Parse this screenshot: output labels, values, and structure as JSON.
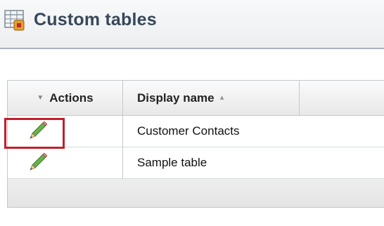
{
  "header": {
    "title": "Custom tables",
    "icon": "custom-tables-icon"
  },
  "grid": {
    "columns": {
      "actions": "Actions",
      "display_name": "Display name",
      "actions_sort_icon": "sort-down-icon",
      "display_name_sort_icon": "sort-up-icon"
    },
    "rows": [
      {
        "action_icon": "pencil-edit-icon",
        "display_name": "Customer Contacts",
        "highlighted": true
      },
      {
        "action_icon": "pencil-edit-icon",
        "display_name": "Sample table",
        "highlighted": false
      }
    ]
  },
  "colors": {
    "title": "#36485a",
    "highlight": "#c0202a",
    "pencil_body": "#6ab04c"
  }
}
